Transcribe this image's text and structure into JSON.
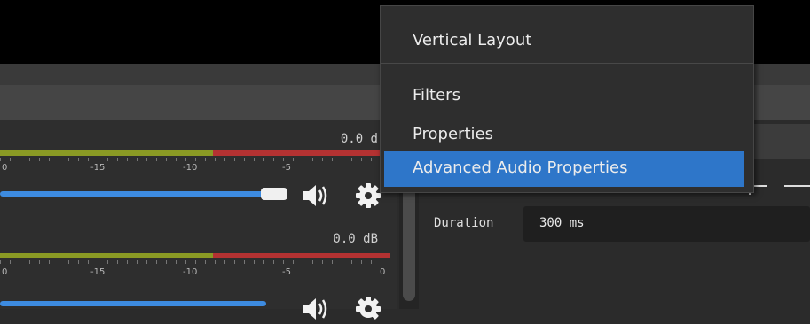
{
  "context_menu": {
    "items": [
      {
        "label": "Vertical Layout"
      },
      {
        "label": "Filters"
      },
      {
        "label": "Properties"
      },
      {
        "label": "Advanced Audio Properties",
        "selected": true
      }
    ]
  },
  "mixer": {
    "channels": [
      {
        "db_label": "0.0 d",
        "tick_labels": [
          "0",
          "-15",
          "-10",
          "-5"
        ]
      },
      {
        "db_label": "0.0 dB",
        "tick_labels": [
          "0",
          "-15",
          "-10",
          "-5",
          "0"
        ]
      }
    ]
  },
  "properties_panel": {
    "duration_label": "Duration",
    "duration_value": "300 ms"
  },
  "icons": {
    "speaker": "speaker-icon",
    "gear": "gear-icon"
  },
  "colors": {
    "selection": "#2e76c9",
    "slider": "#3d8be0",
    "meter_green": "#8a9a24",
    "meter_red": "#b43232"
  }
}
